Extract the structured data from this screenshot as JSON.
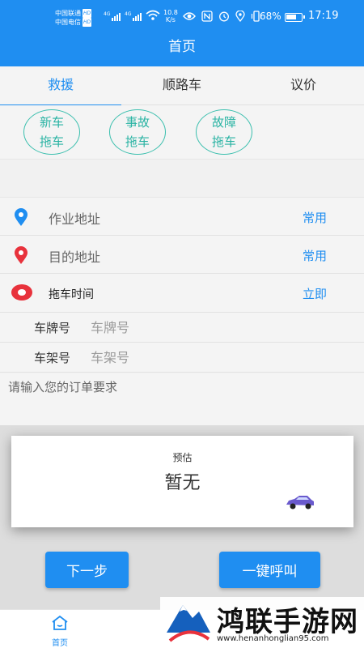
{
  "status_bar": {
    "carrier1": "中国联通",
    "carrier2": "中国电信",
    "hd": "HD",
    "net": "4G",
    "speed_value": "10.8",
    "speed_unit": "K/s",
    "battery_percent": "68%",
    "battery_level": 0.68,
    "time": "17:19",
    "icons": [
      "eye-icon",
      "nfc-icon",
      "alarm-icon",
      "location-icon",
      "vibrate-icon"
    ]
  },
  "header": {
    "title": "首页"
  },
  "tabs": [
    {
      "label": "救援",
      "active": true
    },
    {
      "label": "顺路车",
      "active": false
    },
    {
      "label": "议价",
      "active": false
    }
  ],
  "service_types": [
    {
      "line1": "新车",
      "line2": "拖车"
    },
    {
      "line1": "事故",
      "line2": "拖车"
    },
    {
      "line1": "故障",
      "line2": "拖车"
    }
  ],
  "form": {
    "work_address": {
      "label": "作业地址",
      "action": "常用",
      "icon": "pin-blue-icon"
    },
    "destination": {
      "label": "目的地址",
      "action": "常用",
      "icon": "pin-red-icon"
    },
    "tow_time": {
      "label": "拖车时间",
      "action": "立即",
      "icon": "clock-red-icon"
    },
    "plate": {
      "label": "车牌号",
      "placeholder": "车牌号",
      "value": ""
    },
    "frame": {
      "label": "车架号",
      "placeholder": "车架号",
      "value": ""
    },
    "requirements": {
      "placeholder": "请输入您的订单要求",
      "value": ""
    }
  },
  "estimate": {
    "label": "预估",
    "value": "暂无",
    "icon": "car-icon"
  },
  "buttons": {
    "next": "下一步",
    "call": "一键呼叫"
  },
  "bottom_nav": {
    "home_label": "首页",
    "home_icon": "home-icon"
  },
  "watermark": {
    "title": "鸿联手游网",
    "url": "www.henanhonglian95.com"
  },
  "colors": {
    "primary": "#1f8ef1",
    "teal": "#29b3a3",
    "red": "#e8323c"
  }
}
